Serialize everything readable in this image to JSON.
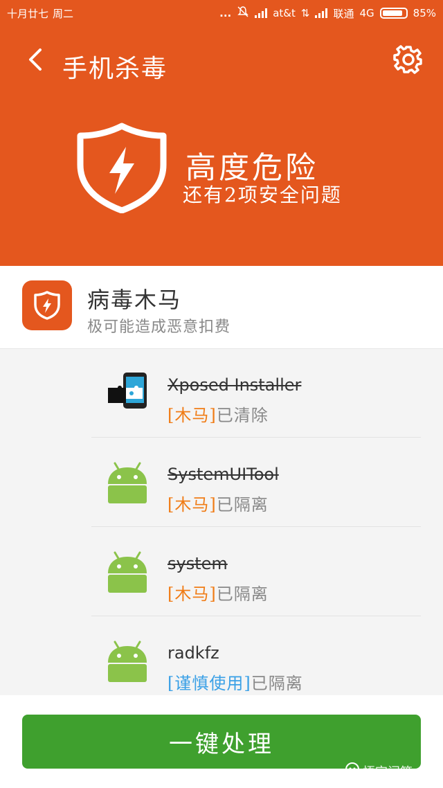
{
  "status_bar": {
    "date": "十月廿七",
    "weekday": "周二",
    "dots": "...",
    "carrier1": "at&t",
    "carrier2": "联通",
    "network": "4G",
    "battery_percent": "85%",
    "battery_level": 0.85
  },
  "nav": {
    "back_icon": "chevron-left-icon",
    "title": "手机杀毒",
    "settings_icon": "gear-icon"
  },
  "summary": {
    "risk_title": "高度危险",
    "risk_subtitle": "还有2项安全问题",
    "icon": "shield-bolt-icon"
  },
  "category": {
    "title": "病毒木马",
    "subtitle": "极可能造成恶意扣费",
    "icon": "shield-bolt-icon"
  },
  "apps": [
    {
      "name": "Xposed Installer",
      "icon": "xposed-puzzle-icon",
      "tag": "[木马]",
      "status": "已清除"
    },
    {
      "name": "SystemUITool",
      "icon": "android-icon",
      "tag": "[木马]",
      "status": "已隔离"
    },
    {
      "name": "system",
      "icon": "android-icon",
      "tag": "[木马]",
      "status": "已隔离"
    },
    {
      "name": "radkfz",
      "icon": "android-icon",
      "tag": "[谨慎使用]",
      "status": "已隔离"
    }
  ],
  "action": {
    "label": "一键处理"
  },
  "watermark": "悟空问答",
  "colors": {
    "header": "#e4571e",
    "action": "#3fa02e",
    "tag_trojan": "#f07c16",
    "tag_caution": "#3aa0e6",
    "android": "#8bc34a"
  }
}
